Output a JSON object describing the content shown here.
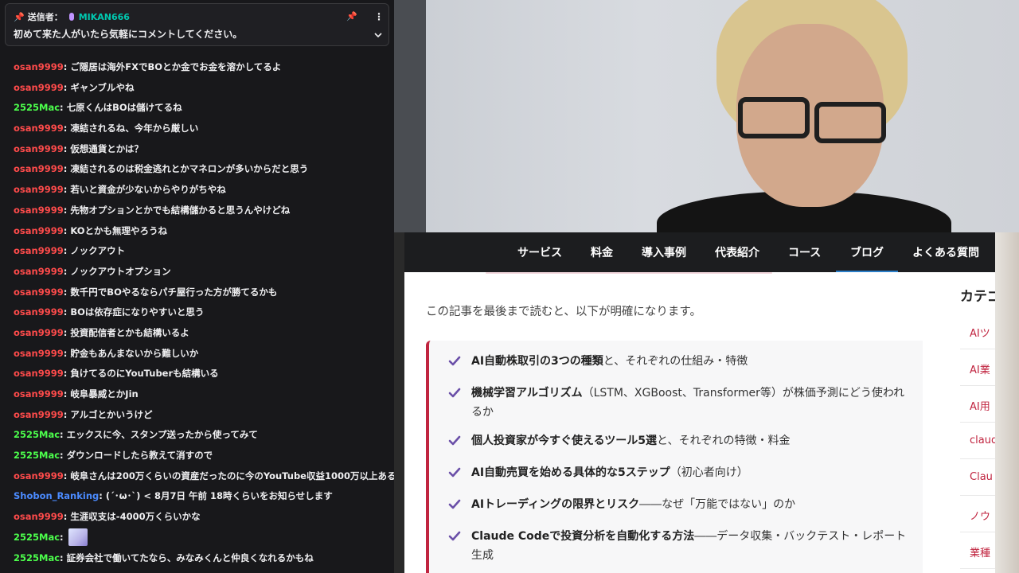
{
  "pinned": {
    "sender_label": "送信者：",
    "sender_name": "MIKAN666",
    "message": "初めて来た人がいたら気軽にコメントしてください。"
  },
  "colors": {
    "osan": "#ff4b4b",
    "mac": "#4cff4c",
    "shobon": "#4b8bff"
  },
  "chat": [
    {
      "user": "osan9999",
      "color": "osan",
      "text": "ご隠居は海外FXでBOとか金でお金を溶かしてるよ"
    },
    {
      "user": "osan9999",
      "color": "osan",
      "text": "ギャンブルやね"
    },
    {
      "user": "2525Mac",
      "color": "mac",
      "text": "七原くんはBOは儲けてるね"
    },
    {
      "user": "osan9999",
      "color": "osan",
      "text": "凍結されるね、今年から厳しい"
    },
    {
      "user": "osan9999",
      "color": "osan",
      "text": "仮想通貨とかは？"
    },
    {
      "user": "osan9999",
      "color": "osan",
      "text": "凍結されるのは税金逃れとかマネロンが多いからだと思う"
    },
    {
      "user": "osan9999",
      "color": "osan",
      "text": "若いと資金が少ないからやりがちやね"
    },
    {
      "user": "osan9999",
      "color": "osan",
      "text": "先物オプションとかでも結構儲かると思うんやけどね"
    },
    {
      "user": "osan9999",
      "color": "osan",
      "text": "KOとかも無理やろうね"
    },
    {
      "user": "osan9999",
      "color": "osan",
      "text": "ノックアウト"
    },
    {
      "user": "osan9999",
      "color": "osan",
      "text": "ノックアウトオプション"
    },
    {
      "user": "osan9999",
      "color": "osan",
      "text": "数千円でBOやるならパチ屋行った方が勝てるかも"
    },
    {
      "user": "osan9999",
      "color": "osan",
      "text": "BOは依存症になりやすいと思う"
    },
    {
      "user": "osan9999",
      "color": "osan",
      "text": "投資配信者とかも結構いるよ"
    },
    {
      "user": "osan9999",
      "color": "osan",
      "text": "貯金もあんまないから難しいか"
    },
    {
      "user": "osan9999",
      "color": "osan",
      "text": "負けてるのにYouTuberも結構いる"
    },
    {
      "user": "osan9999",
      "color": "osan",
      "text": "岐阜暴威とかJin"
    },
    {
      "user": "osan9999",
      "color": "osan",
      "text": "アルゴとかいうけど"
    },
    {
      "user": "2525Mac",
      "color": "mac",
      "text": "エックスに今、スタンプ送ったから使ってみて"
    },
    {
      "user": "2525Mac",
      "color": "mac",
      "text": "ダウンロードしたら教えて消すので"
    },
    {
      "user": "osan9999",
      "color": "osan",
      "text": "岐阜さんは200万くらいの資産だったのに今のYouTube収益1000万以上あるよ"
    },
    {
      "user": "Shobon_Ranking",
      "color": "shobon",
      "text": "(´･ω･`) < 8月7日 午前 18時くらいをお知らせします"
    },
    {
      "user": "osan9999",
      "color": "osan",
      "text": "生涯収支は-4000万くらいかな"
    },
    {
      "user": "2525Mac",
      "color": "mac",
      "text": "",
      "emote": true
    },
    {
      "user": "2525Mac",
      "color": "mac",
      "text": "証券会社で働いてたなら、みなみくんと仲良くなれるかもね"
    }
  ],
  "nav": [
    "サービス",
    "料金",
    "導入事例",
    "代表紹介",
    "コース",
    "ブログ",
    "よくある質問"
  ],
  "nav_active": 5,
  "intro": "この記事を最後まで読むと、以下が明確になります。",
  "checklist": [
    {
      "bold": "AI自動株取引の3つの種類",
      "rest": "と、それぞれの仕組み・特徴"
    },
    {
      "bold": "機械学習アルゴリズム",
      "rest": "（LSTM、XGBoost、Transformer等）が株価予測にどう使われるか"
    },
    {
      "bold": "個人投資家が今すぐ使えるツール5選",
      "rest": "と、それぞれの特徴・料金"
    },
    {
      "bold": "AI自動売買を始める具体的な5ステップ",
      "rest": "（初心者向け）"
    },
    {
      "bold": "AIトレーディングの限界とリスク",
      "rest": "――なぜ「万能ではない」のか"
    },
    {
      "bold": "Claude Codeで投資分析を自動化する方法",
      "rest": "――データ収集・バックテスト・レポート生成"
    }
  ],
  "sidebar": {
    "title": "カテゴ",
    "items": [
      "AIツ",
      "AI業",
      "AI用",
      "claud",
      "Clau",
      "ノウ",
      "業種"
    ]
  }
}
